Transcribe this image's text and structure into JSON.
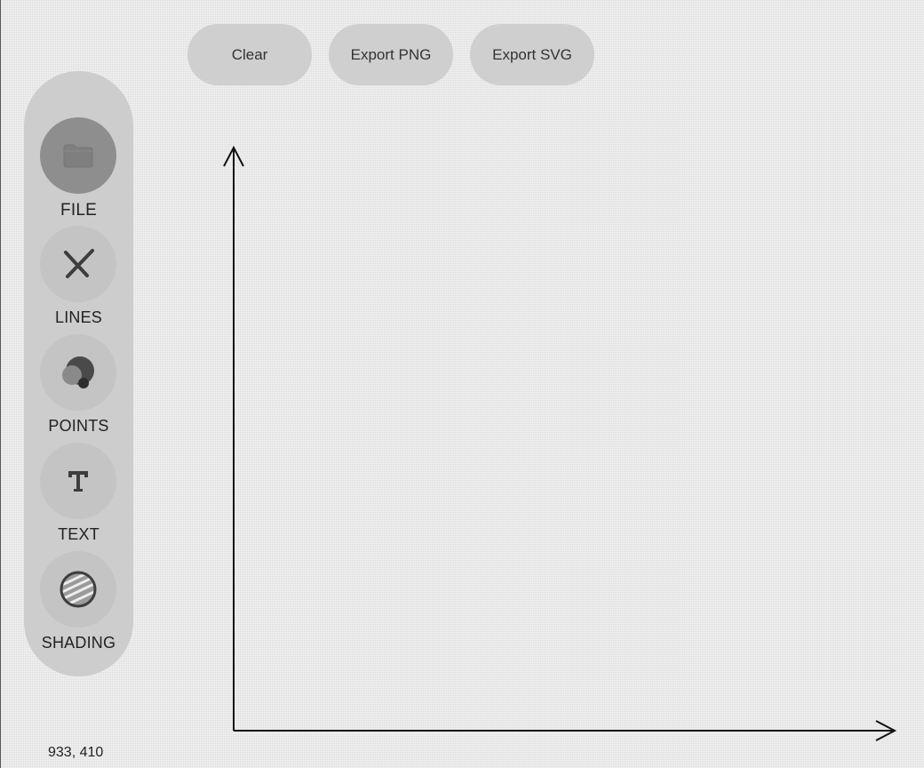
{
  "top_buttons": {
    "clear": "Clear",
    "export_png": "Export PNG",
    "export_svg": "Export SVG"
  },
  "toolbar": {
    "tools": [
      {
        "label": "FILE",
        "icon": "folder-icon",
        "active": true
      },
      {
        "label": "LINES",
        "icon": "lines-icon",
        "active": false
      },
      {
        "label": "POINTS",
        "icon": "points-icon",
        "active": false
      },
      {
        "label": "TEXT",
        "icon": "text-icon",
        "active": false
      },
      {
        "label": "SHADING",
        "icon": "shading-icon",
        "active": false
      }
    ]
  },
  "status": {
    "coordinates": "933, 410"
  },
  "colors": {
    "background": "#e9e9e9",
    "toolbar": "#cdcdcd",
    "button": "#cfcfcf",
    "tool_circle": "#c4c4c4",
    "active_tool_circle": "#8e8e8e",
    "axis_stroke": "#111111"
  }
}
